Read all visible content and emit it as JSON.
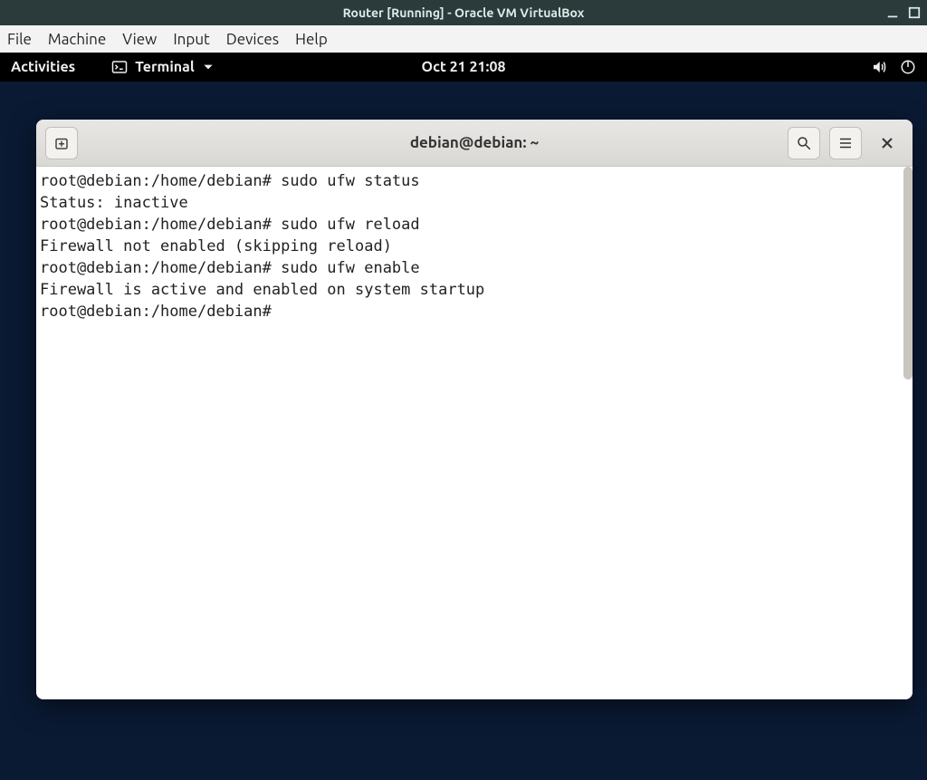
{
  "vbox": {
    "title": "Router [Running] - Oracle VM VirtualBox",
    "menu": [
      "File",
      "Machine",
      "View",
      "Input",
      "Devices",
      "Help"
    ]
  },
  "gnome": {
    "activities": "Activities",
    "app_name": "Terminal",
    "clock": "Oct 21  21:08"
  },
  "terminal": {
    "title": "debian@debian: ~",
    "lines": [
      "root@debian:/home/debian# sudo ufw status",
      "Status: inactive",
      "root@debian:/home/debian# sudo ufw reload",
      "Firewall not enabled (skipping reload)",
      "root@debian:/home/debian# sudo ufw enable",
      "Firewall is active and enabled on system startup",
      "root@debian:/home/debian# "
    ]
  }
}
